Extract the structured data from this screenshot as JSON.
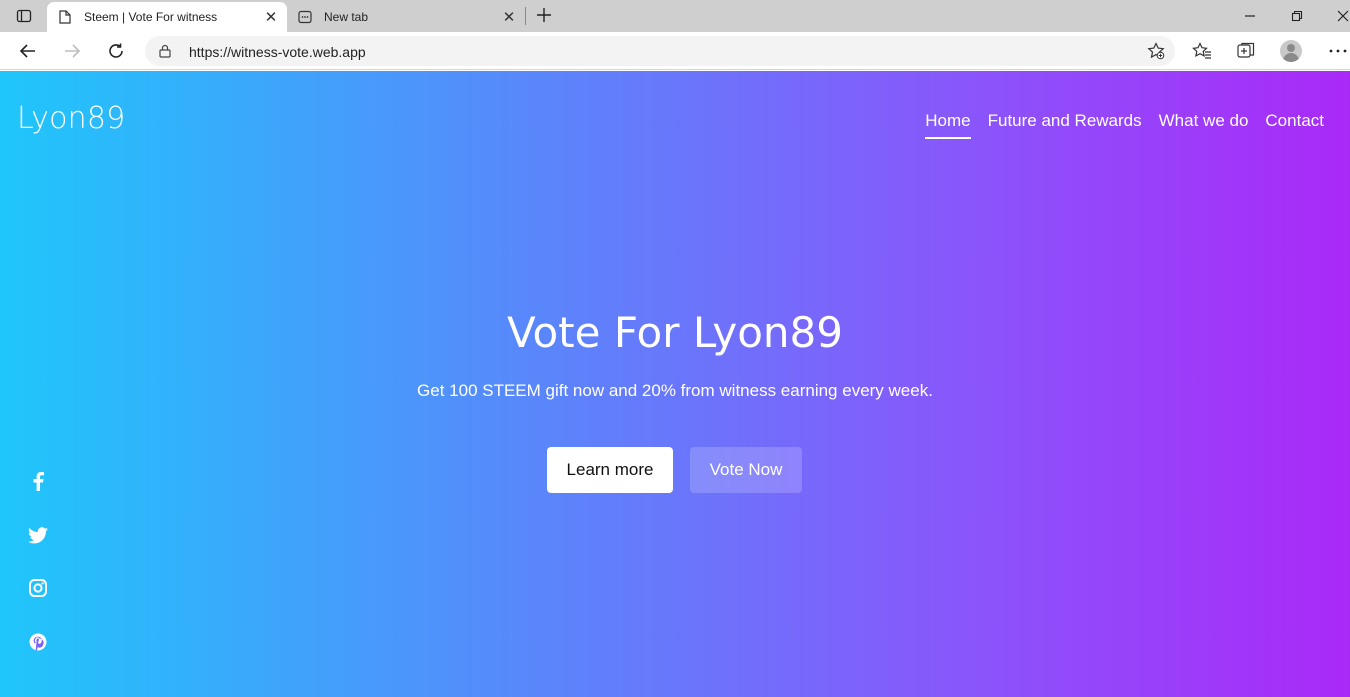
{
  "browser": {
    "tabs": [
      {
        "title": "Steem | Vote For witness",
        "active": true
      },
      {
        "title": "New tab",
        "active": false
      }
    ],
    "url": "https://witness-vote.web.app"
  },
  "site": {
    "logo": "Lyon89",
    "nav": [
      {
        "label": "Home",
        "active": true
      },
      {
        "label": "Future and Rewards"
      },
      {
        "label": "What we do"
      },
      {
        "label": "Contact"
      }
    ]
  },
  "hero": {
    "title": "Vote For Lyon89",
    "subtitle": "Get 100 STEEM gift now and 20% from witness earning every week.",
    "learn_more": "Learn more",
    "vote_now": "Vote Now"
  },
  "social": [
    "facebook-icon",
    "twitter-icon",
    "instagram-icon",
    "pinterest-icon"
  ],
  "colors": {
    "gradient_start": "#1fc6fb",
    "gradient_end": "#aa29f8"
  }
}
